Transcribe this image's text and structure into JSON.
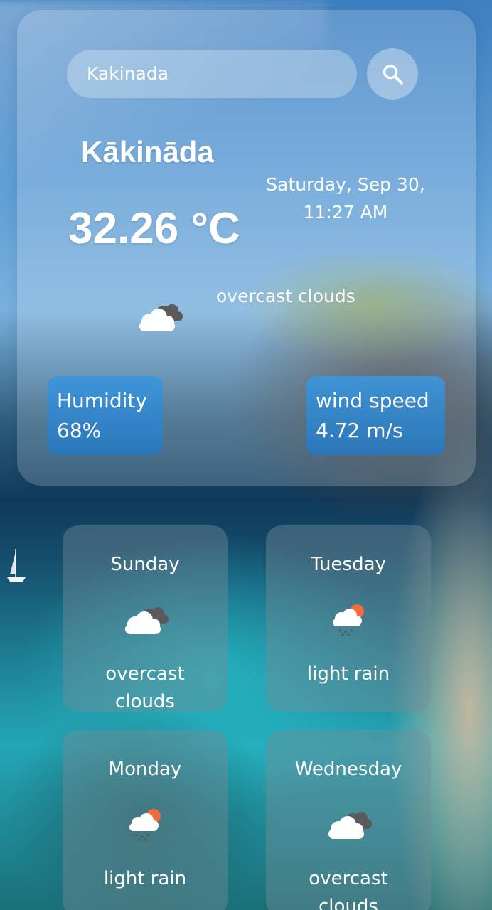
{
  "search": {
    "value": "Kakinada"
  },
  "current": {
    "city": "Kākināda",
    "date": "Saturday, Sep 30,",
    "time": "11:27 AM",
    "temperature": "32.26 °C",
    "condition": "overcast clouds",
    "condition_icon": "overcast-clouds-icon",
    "humidity_label": "Humidity",
    "humidity_value": "68%",
    "wind_label": "wind speed",
    "wind_value": "4.72 m/s"
  },
  "forecast": [
    {
      "day": "Sunday",
      "condition_line1": "overcast",
      "condition_line2": "clouds",
      "icon": "overcast-clouds-icon"
    },
    {
      "day": "Tuesday",
      "condition_line1": "light rain",
      "condition_line2": "",
      "icon": "light-rain-icon"
    },
    {
      "day": "Monday",
      "condition_line1": "light rain",
      "condition_line2": "",
      "icon": "light-rain-icon"
    },
    {
      "day": "Wednesday",
      "condition_line1": "overcast",
      "condition_line2": "clouds",
      "icon": "overcast-clouds-icon"
    }
  ],
  "colors": {
    "stat_box": "#3c96dc",
    "card_glass": "#ffffff2e",
    "text": "#ffffff"
  }
}
